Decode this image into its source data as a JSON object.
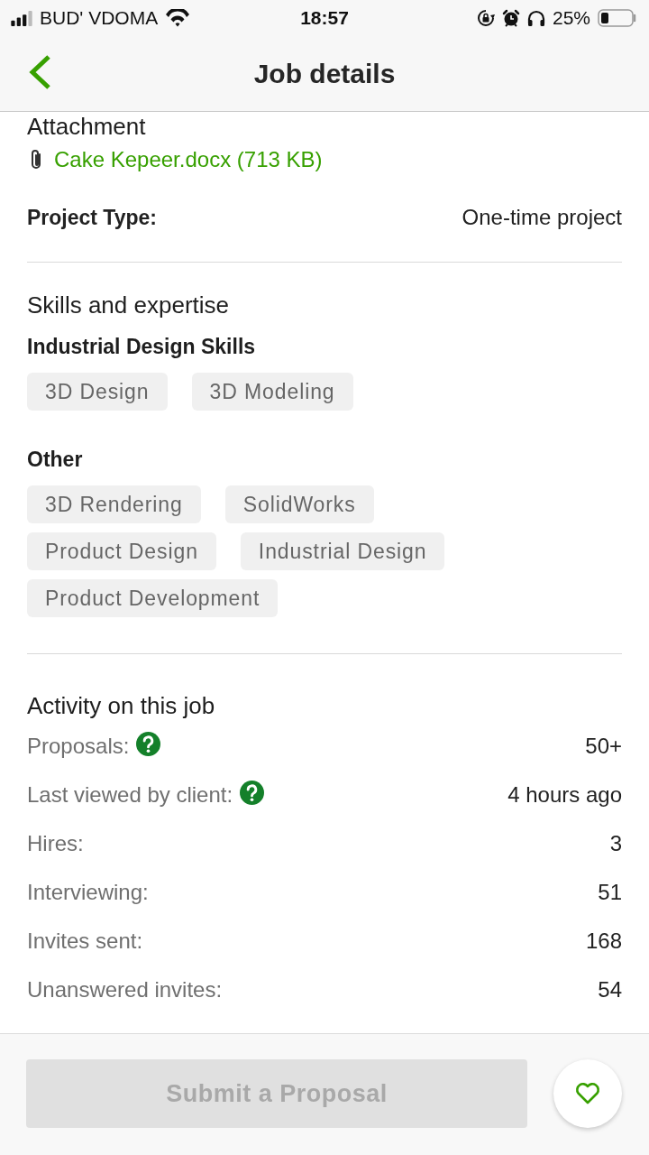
{
  "status_bar": {
    "carrier": "BUD' VDOMA",
    "time": "18:57",
    "battery": "25%"
  },
  "nav": {
    "title": "Job details"
  },
  "attachment": {
    "heading": "Attachment",
    "file": "Cake Kepeer.docx (713 KB)"
  },
  "project_type": {
    "label": "Project Type:",
    "value": "One-time project"
  },
  "skills": {
    "heading": "Skills and expertise",
    "groups": [
      {
        "title": "Industrial Design Skills",
        "tags": [
          "3D Design",
          "3D Modeling"
        ]
      },
      {
        "title": "Other",
        "tags": [
          "3D Rendering",
          "SolidWorks",
          "Product Design",
          "Industrial Design",
          "Product Development"
        ]
      }
    ]
  },
  "activity": {
    "heading": "Activity on this job",
    "rows": [
      {
        "label": "Proposals:",
        "value": "50+",
        "help": true
      },
      {
        "label": "Last viewed by client:",
        "value": "4 hours ago",
        "help": true
      },
      {
        "label": "Hires:",
        "value": "3",
        "help": false
      },
      {
        "label": "Interviewing:",
        "value": "51",
        "help": false
      },
      {
        "label": "Invites sent:",
        "value": "168",
        "help": false
      },
      {
        "label": "Unanswered invites:",
        "value": "54",
        "help": false
      }
    ]
  },
  "footer": {
    "submit": {
      "label": "Submit a Proposal",
      "disabled": true
    },
    "favorite": {
      "saved": false
    }
  }
}
